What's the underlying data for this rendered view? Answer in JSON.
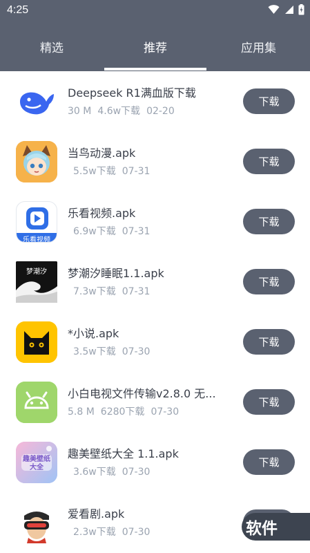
{
  "status_bar": {
    "time": "4:25",
    "icons": [
      "wifi-icon",
      "signal-icon",
      "battery-charging-icon"
    ]
  },
  "tabs": [
    {
      "label": "精选",
      "active": false
    },
    {
      "label": "推荐",
      "active": true
    },
    {
      "label": "应用集",
      "active": false
    }
  ],
  "colors": {
    "header": "#5a6170",
    "button": "#5a6170",
    "meta_text": "#9aa3b0",
    "title_text": "#3a3f4a"
  },
  "apps": [
    {
      "name": "Deepseek R1满血版下载",
      "size": "30 M",
      "downloads": "4.6w下载",
      "date": "02-20",
      "button": "下载",
      "icon": "deepseek-whale-icon"
    },
    {
      "name": "当鸟动漫.apk",
      "size": "",
      "downloads": "5.5w下载",
      "date": "07-31",
      "button": "下载",
      "icon": "anime-girl-icon"
    },
    {
      "name": "乐看视频.apk",
      "size": "",
      "downloads": "6.9w下载",
      "date": "07-31",
      "button": "下载",
      "icon": "lekan-video-icon",
      "icon_caption": "乐看视频"
    },
    {
      "name": "梦潮汐睡眠1.1.apk",
      "size": "",
      "downloads": "7.3w下载",
      "date": "07-31",
      "button": "下载",
      "icon": "wave-icon",
      "icon_caption": "梦潮汐"
    },
    {
      "name": "*小说.apk",
      "size": "",
      "downloads": "3.5w下载",
      "date": "07-30",
      "button": "下载",
      "icon": "black-cat-icon"
    },
    {
      "name": "小白电视文件传输v2.8.0 无...",
      "size": "5.8 M",
      "downloads": "6280下载",
      "date": "07-30",
      "button": "下载",
      "icon": "android-icon"
    },
    {
      "name": "趣美壁纸大全 1.1.apk",
      "size": "",
      "downloads": "3.6w下载",
      "date": "07-30",
      "button": "下载",
      "icon": "wallpaper-icon",
      "icon_caption": "趣美壁纸大全"
    },
    {
      "name": "爱看剧.apk",
      "size": "",
      "downloads": "2.3w下载",
      "date": "07-30",
      "button": "下载",
      "icon": "vr-headset-icon"
    }
  ],
  "watermark": "软件"
}
